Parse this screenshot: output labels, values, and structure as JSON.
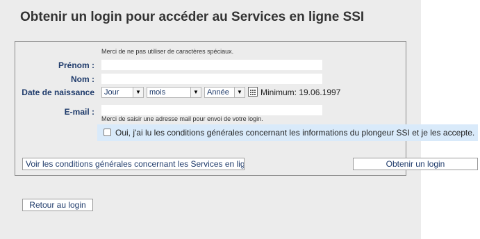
{
  "page": {
    "title": "Obtenir un login pour accéder au Services en ligne SSI"
  },
  "form": {
    "hint_top": "Merci de ne pas utiliser de caractères spéciaux.",
    "firstname_label": "Prénom :",
    "firstname_value": "",
    "lastname_label": "Nom :",
    "lastname_value": "",
    "birthdate_label": "Date de naissance",
    "day_select": "Jour",
    "month_select": "mois",
    "year_select": "Année",
    "calendar_icon": "calendar-icon",
    "min_date": "Minimum: 19.06.1997",
    "email_label": "E-mail :",
    "email_value": "",
    "email_hint": "Merci de saisir une adresse mail pour envoi de votre login.",
    "accept_checked": false,
    "accept_text": "Oui, j'ai lu les conditions générales concernant les informations du plongeur SSI et je les accepte."
  },
  "buttons": {
    "view_conditions": "Voir les conditions générales concernant les Services en ligne",
    "get_login": "Obtenir un login",
    "back_to_login": "Retour au login"
  },
  "colors": {
    "label": "#1f3b6b",
    "panel_bg": "#ececec",
    "accept_highlight": "#d9eafa"
  }
}
